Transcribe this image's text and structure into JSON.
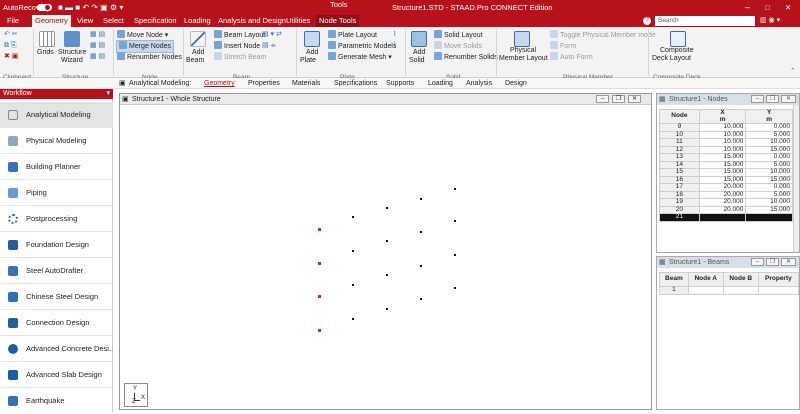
{
  "title": {
    "autorecovery": "AutoRecovery",
    "toggle_state": "ON",
    "app_title": "Structure1.STD - STAAD.Pro CONNECT Edition",
    "tools_label": "Tools",
    "search_placeholder": "Search"
  },
  "tabs": [
    "File",
    "Geometry",
    "View",
    "Select",
    "Specification",
    "Loading",
    "Analysis and Design",
    "Utilities",
    "Node Tools"
  ],
  "ribbon": {
    "clipboard_label": "Clipboard",
    "structure": {
      "grids": "Grids",
      "wizard_line1": "Structure",
      "wizard_line2": "Wizard",
      "label": "Structure"
    },
    "node": {
      "move": "Move Node",
      "merge": "Merge Nodes",
      "renumber": "Renumber Nodes",
      "label": "Node"
    },
    "beam": {
      "add_line1": "Add",
      "add_line2": "Beam",
      "layout": "Beam Layout",
      "insert": "Insert Node",
      "stretch": "Stretch Beam",
      "label": "Beam"
    },
    "plate": {
      "add_line1": "Add",
      "add_line2": "Plate",
      "layout": "Plate Layout",
      "parametric": "Parametric Models",
      "mesh": "Generate Mesh",
      "label": "Plate"
    },
    "solid": {
      "add_line1": "Add",
      "add_line2": "Solid",
      "layout": "Solid Layout",
      "move": "Move Solids",
      "renumber": "Renumber Solids",
      "label": "Solid"
    },
    "physical": {
      "layout_line1": "Physical",
      "layout_line2": "Member Layout",
      "toggle": "Toggle Physical Member mode",
      "form": "Form",
      "auto": "Auto Form",
      "label": "Physical Member"
    },
    "composite": {
      "layout_line1": "Composite",
      "layout_line2": "Deck Layout",
      "label": "Composite Deck"
    }
  },
  "subtabs": {
    "prefix": "Analytical Modeling:",
    "items": [
      "Geometry",
      "Properties",
      "Materials",
      "Specifications",
      "Supports",
      "Loading",
      "Analysis",
      "Design"
    ]
  },
  "workflow": {
    "header": "Workflow",
    "items": [
      "Analytical Modeling",
      "Physical Modeling",
      "Building Planner",
      "Piping",
      "Postprocessing",
      "Foundation Design",
      "Steel AutoDrafter",
      "Chinese Steel Design",
      "Connection Design",
      "Advanced Concrete Desi...",
      "Advanced Slab Design",
      "Earthquake"
    ]
  },
  "viewport": {
    "title": "Structure1 - Whole Structure",
    "axis_y": "Y",
    "axis_x": "X",
    "axis_z": "Z"
  },
  "nodes_panel": {
    "title": "Structure1 - Nodes",
    "columns": [
      "Node",
      "X",
      "Y"
    ],
    "units": [
      "",
      "m",
      "m"
    ],
    "rows": [
      [
        "9",
        "10.000",
        "0.000"
      ],
      [
        "10",
        "10.000",
        "5.000"
      ],
      [
        "11",
        "10.000",
        "10.000"
      ],
      [
        "12",
        "10.000",
        "15.000"
      ],
      [
        "13",
        "15.000",
        "0.000"
      ],
      [
        "14",
        "15.000",
        "5.000"
      ],
      [
        "15",
        "15.000",
        "10.000"
      ],
      [
        "16",
        "15.000",
        "15.000"
      ],
      [
        "17",
        "20.000",
        "0.000"
      ],
      [
        "18",
        "20.000",
        "5.000"
      ],
      [
        "19",
        "20.000",
        "10.000"
      ],
      [
        "20",
        "20.000",
        "15.000"
      ],
      [
        "21",
        "",
        ""
      ]
    ]
  },
  "beams_panel": {
    "title": "Structure1 - Beams",
    "columns": [
      "Beam",
      "Node A",
      "Node B",
      "Property"
    ],
    "rows": [
      [
        "1",
        "",
        "",
        ""
      ]
    ]
  },
  "colors": {
    "brand": "#b5121b",
    "support_node": "#d9231b"
  }
}
